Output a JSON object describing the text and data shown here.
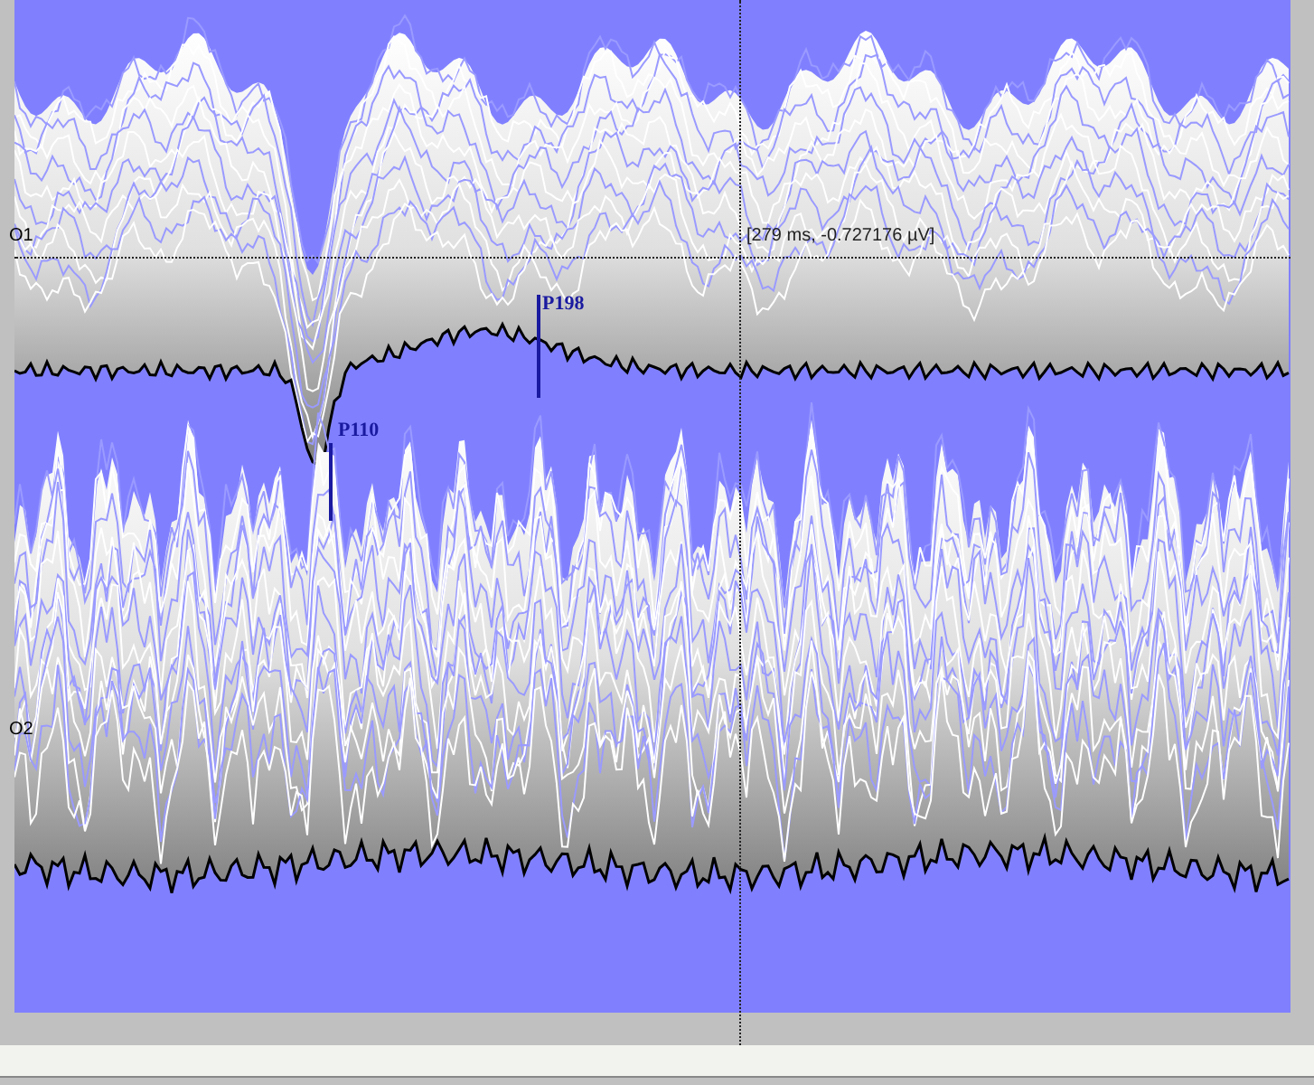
{
  "channels": [
    {
      "label": "O1"
    },
    {
      "label": "O2"
    }
  ],
  "peaks": [
    {
      "label": "P110"
    },
    {
      "label": "P198"
    }
  ],
  "cursor": {
    "readout": "[279 ms, -0.727176 µV]"
  }
}
